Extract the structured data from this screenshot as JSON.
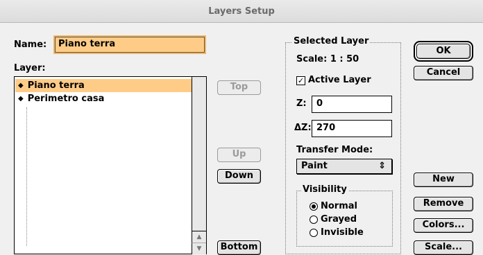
{
  "window": {
    "title": "Layers Setup"
  },
  "name_field": {
    "label": "Name:",
    "value": "Piano terra"
  },
  "layer_list": {
    "label": "Layer:",
    "items": [
      {
        "label": "Piano terra",
        "selected": true
      },
      {
        "label": "Perimetro casa",
        "selected": false
      }
    ]
  },
  "reorder_buttons": {
    "top": "Top",
    "up": "Up",
    "down": "Down",
    "bottom": "Bottom"
  },
  "selected_layer": {
    "legend": "Selected Layer",
    "scale": "Scale: 1 : 50",
    "active_layer_label": "Active Layer",
    "active_layer_checked": true,
    "z_label": "Z:",
    "z_value": "0",
    "dz_label": "ΔZ:",
    "dz_value": "270",
    "transfer_mode_label": "Transfer Mode:",
    "transfer_mode_value": "Paint"
  },
  "visibility": {
    "legend": "Visibility",
    "options": [
      "Normal",
      "Grayed",
      "Invisible"
    ],
    "selected": "Normal"
  },
  "dialog_buttons": {
    "ok": "OK",
    "cancel": "Cancel",
    "new": "New",
    "remove": "Remove",
    "colors": "Colors...",
    "scale": "Scale..."
  },
  "icons": {
    "list_bullet": "◆",
    "check": "✓",
    "popup_arrows": "⇕",
    "scroll_up": "▲",
    "scroll_down": "▼"
  }
}
